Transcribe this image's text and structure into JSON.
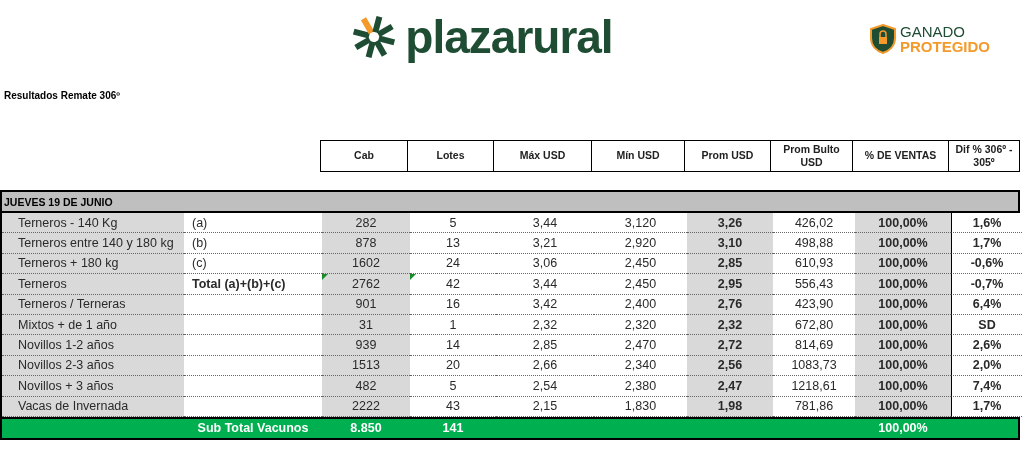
{
  "header": {
    "brand": "plazarural",
    "partner_top": "GANADO",
    "partner_bottom": "PROTEGIDO"
  },
  "title": "Resultados Remate 306º",
  "columns": [
    "Cab",
    "Lotes",
    "Máx USD",
    "Mín USD",
    "Prom USD",
    "Prom Bulto USD",
    "% DE VENTAS",
    "Dif % 306º - 305º"
  ],
  "day": "JUEVES 19 DE JUNIO",
  "rows": [
    {
      "label": "Terneros - 140 Kg",
      "note": "(a)",
      "note_bold": false,
      "flagged": false,
      "values": [
        "282",
        "5",
        "3,44",
        "3,120",
        "3,26",
        "426,02",
        "100,00%",
        "1,6%"
      ]
    },
    {
      "label": "Terneros entre 140 y 180 kg",
      "note": "(b)",
      "note_bold": false,
      "flagged": false,
      "values": [
        "878",
        "13",
        "3,21",
        "2,920",
        "3,10",
        "498,88",
        "100,00%",
        "1,7%"
      ]
    },
    {
      "label": "Terneros + 180 kg",
      "note": "(c)",
      "note_bold": false,
      "flagged": false,
      "values": [
        "1602",
        "24",
        "3,06",
        "2,450",
        "2,85",
        "610,93",
        "100,00%",
        "-0,6%"
      ]
    },
    {
      "label": "Terneros",
      "note": "Total (a)+(b)+(c)",
      "note_bold": true,
      "flagged": true,
      "values": [
        "2762",
        "42",
        "3,44",
        "2,450",
        "2,95",
        "556,43",
        "100,00%",
        "-0,7%"
      ]
    },
    {
      "label": "Terneros / Terneras",
      "flagged": false,
      "values": [
        "901",
        "16",
        "3,42",
        "2,400",
        "2,76",
        "423,90",
        "100,00%",
        "6,4%"
      ]
    },
    {
      "label": "Mixtos + de 1 año",
      "flagged": false,
      "values": [
        "31",
        "1",
        "2,32",
        "2,320",
        "2,32",
        "672,80",
        "100,00%",
        "SD"
      ]
    },
    {
      "label": "Novillos 1-2 años",
      "flagged": false,
      "values": [
        "939",
        "14",
        "2,85",
        "2,470",
        "2,72",
        "814,69",
        "100,00%",
        "2,6%"
      ]
    },
    {
      "label": "Novillos 2-3 años",
      "flagged": false,
      "values": [
        "1513",
        "20",
        "2,66",
        "2,340",
        "2,56",
        "1083,73",
        "100,00%",
        "2,0%"
      ]
    },
    {
      "label": "Novillos + 3 años",
      "flagged": false,
      "values": [
        "482",
        "5",
        "2,54",
        "2,380",
        "2,47",
        "1218,61",
        "100,00%",
        "7,4%"
      ]
    },
    {
      "label": "Vacas de Invernada",
      "flagged": false,
      "values": [
        "2222",
        "43",
        "2,15",
        "1,830",
        "1,98",
        "781,86",
        "100,00%",
        "1,7%"
      ]
    }
  ],
  "subtotal": {
    "label": "Sub Total Vacunos",
    "cab": "8.850",
    "lotes": "141",
    "ventas": "100,00%"
  }
}
